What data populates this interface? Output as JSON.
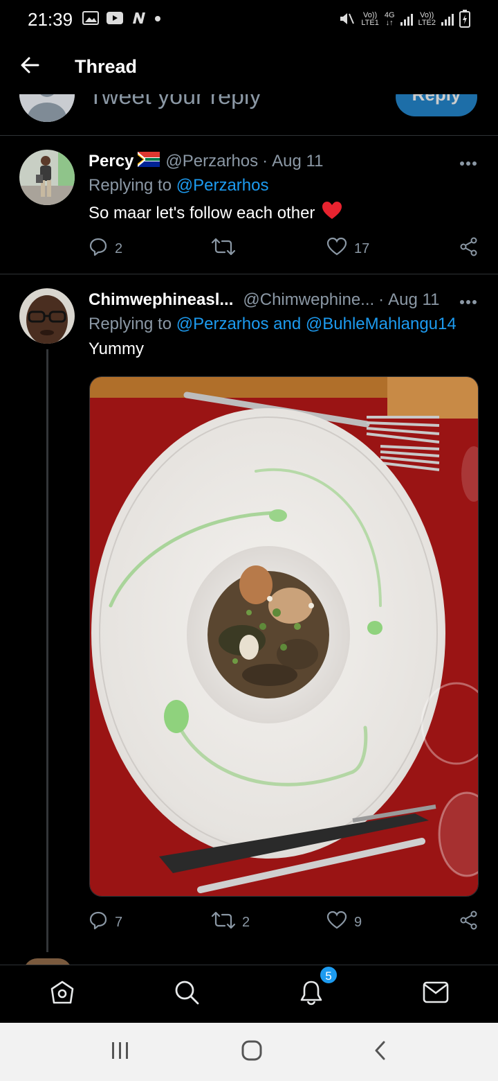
{
  "status_bar": {
    "time": "21:39",
    "left_icons": [
      "gallery-icon",
      "video-icon",
      "n-app-icon",
      "dot-icon"
    ],
    "right_icons": [
      "mute-icon",
      "signal-lte1-icon",
      "signal-lte2-icon",
      "battery-charging-icon"
    ],
    "sim1": {
      "top": "Vo))",
      "bottom": "LTE1"
    },
    "network": {
      "top": "4G",
      "bottom": "↓↑"
    },
    "sim2": {
      "top": "Vo))",
      "bottom": "LTE2"
    }
  },
  "header": {
    "back_icon": "arrow-left-icon",
    "title": "Thread"
  },
  "composer": {
    "placeholder": "Tweet your reply",
    "button_label": "Reply"
  },
  "tweets": [
    {
      "name": "Percy",
      "flag": "south-africa-flag",
      "handle": "@Perzarhos",
      "date": "Aug 11",
      "replying_prefix": "Replying to",
      "replying_to": "@Perzarhos",
      "text": "So maar let's follow each other",
      "emoji": "red-heart",
      "replies": "2",
      "retweets": "",
      "likes": "17"
    },
    {
      "name": "Chimwephineasl...",
      "handle": "@Chimwephine...",
      "date": "Aug 11",
      "replying_prefix": "Replying to",
      "replying_to": "@Perzarhos and @BuhleMahlangu14",
      "text": "Yummy",
      "media": "photo of a plated frog-leg dish on a white bowl with fork and knife on red placemat",
      "replies": "7",
      "retweets": "2",
      "likes": "9"
    }
  ],
  "bottom_nav": {
    "items": [
      "home-icon",
      "search-icon",
      "notifications-icon",
      "messages-icon"
    ],
    "notifications_badge": "5"
  },
  "system_nav": [
    "recents-icon",
    "home-circle-icon",
    "back-chevron-icon"
  ],
  "colors": {
    "background": "#000000",
    "accent": "#1d9bf0",
    "muted_text": "#8b98a5",
    "divider": "#2f3336",
    "heart": "#f4212e"
  }
}
